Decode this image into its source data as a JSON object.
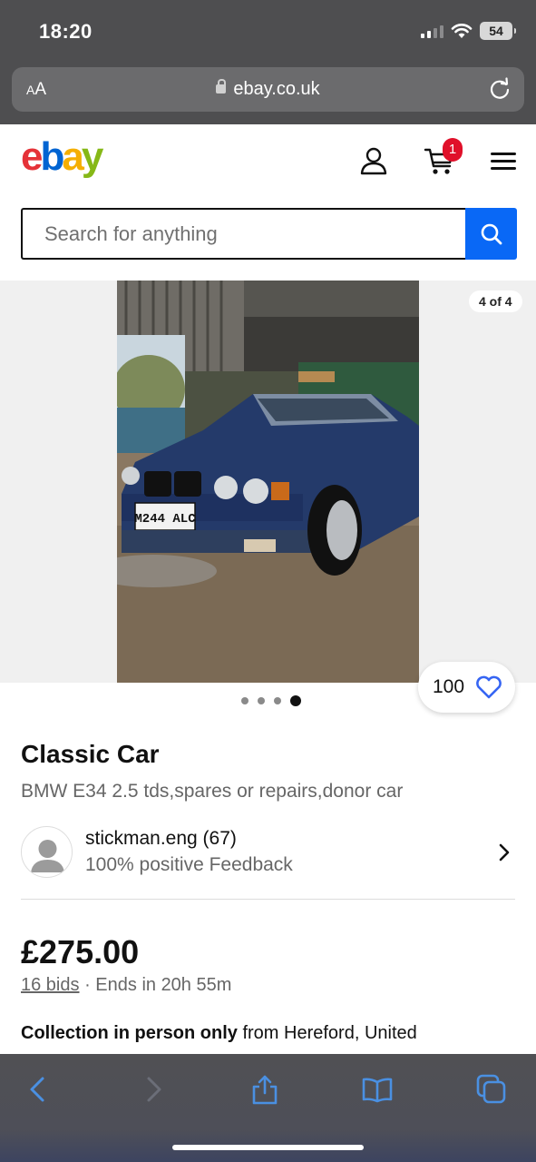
{
  "status_bar": {
    "time": "18:20",
    "battery": "54"
  },
  "browser": {
    "text_size_label_small": "A",
    "text_size_label_large": "A",
    "url": "ebay.co.uk"
  },
  "header": {
    "logo": {
      "e": "e",
      "b": "b",
      "a": "a",
      "y": "y"
    },
    "cart_count": "1",
    "search_placeholder": "Search for anything"
  },
  "gallery": {
    "photo_counter": "4 of 4",
    "number_plate": "M244 ALC",
    "watch_count": "100",
    "dots_total": 4,
    "dots_active_index": 3
  },
  "listing": {
    "title": "Classic Car",
    "subtitle": "BMW E34 2.5 tds,spares or repairs,donor car",
    "seller_name": "stickman.eng (67)",
    "seller_feedback": "100% positive Feedback",
    "price": "£275.00",
    "bids": "16 bids",
    "separator": "·",
    "ends_in": "Ends in 20h 55m",
    "collection_bold": "Collection in person only",
    "collection_rest": "from Hereford, United"
  },
  "colors": {
    "ebay_red": "#e53238",
    "ebay_blue": "#0064d2",
    "ebay_yellow": "#f5af02",
    "ebay_green": "#86b817",
    "search_button": "#0968f6",
    "cart_badge": "#e0102a",
    "safari_blue": "#4a90e2"
  }
}
